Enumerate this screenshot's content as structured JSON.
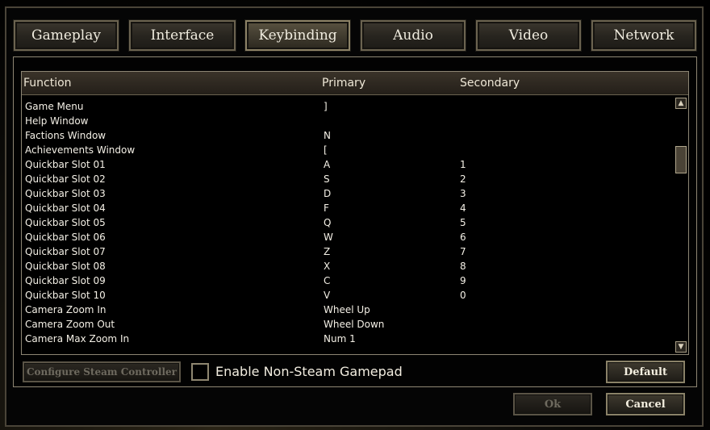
{
  "tabs": [
    {
      "label": "Gameplay"
    },
    {
      "label": "Interface"
    },
    {
      "label": "Keybinding"
    },
    {
      "label": "Audio"
    },
    {
      "label": "Video"
    },
    {
      "label": "Network"
    }
  ],
  "active_tab": "Keybinding",
  "table": {
    "columns": [
      "Function",
      "Primary",
      "Secondary"
    ],
    "rows": [
      {
        "function": "Game Menu",
        "primary": "]",
        "secondary": ""
      },
      {
        "function": "Help Window",
        "primary": "",
        "secondary": ""
      },
      {
        "function": "Factions Window",
        "primary": "N",
        "secondary": ""
      },
      {
        "function": "Achievements Window",
        "primary": "[",
        "secondary": ""
      },
      {
        "function": "Quickbar Slot 01",
        "primary": "A",
        "secondary": "1"
      },
      {
        "function": "Quickbar Slot 02",
        "primary": "S",
        "secondary": "2"
      },
      {
        "function": "Quickbar Slot 03",
        "primary": "D",
        "secondary": "3"
      },
      {
        "function": "Quickbar Slot 04",
        "primary": "F",
        "secondary": "4"
      },
      {
        "function": "Quickbar Slot 05",
        "primary": "Q",
        "secondary": "5"
      },
      {
        "function": "Quickbar Slot 06",
        "primary": "W",
        "secondary": "6"
      },
      {
        "function": "Quickbar Slot 07",
        "primary": "Z",
        "secondary": "7"
      },
      {
        "function": "Quickbar Slot 08",
        "primary": "X",
        "secondary": "8"
      },
      {
        "function": "Quickbar Slot 09",
        "primary": "C",
        "secondary": "9"
      },
      {
        "function": "Quickbar Slot 10",
        "primary": "V",
        "secondary": "0"
      },
      {
        "function": "Camera Zoom In",
        "primary": "Wheel Up",
        "secondary": ""
      },
      {
        "function": "Camera Zoom Out",
        "primary": "Wheel Down",
        "secondary": ""
      },
      {
        "function": "Camera Max Zoom In",
        "primary": "Num 1",
        "secondary": ""
      }
    ]
  },
  "scrollbar": {
    "up_icon": "▲",
    "down_icon": "▼"
  },
  "controls": {
    "configure_steam_controller": "Configure Steam Controller",
    "enable_gamepad_label": "Enable Non-Steam Gamepad",
    "enable_gamepad_checked": false,
    "default_label": "Default",
    "ok_label": "Ok",
    "cancel_label": "Cancel"
  }
}
